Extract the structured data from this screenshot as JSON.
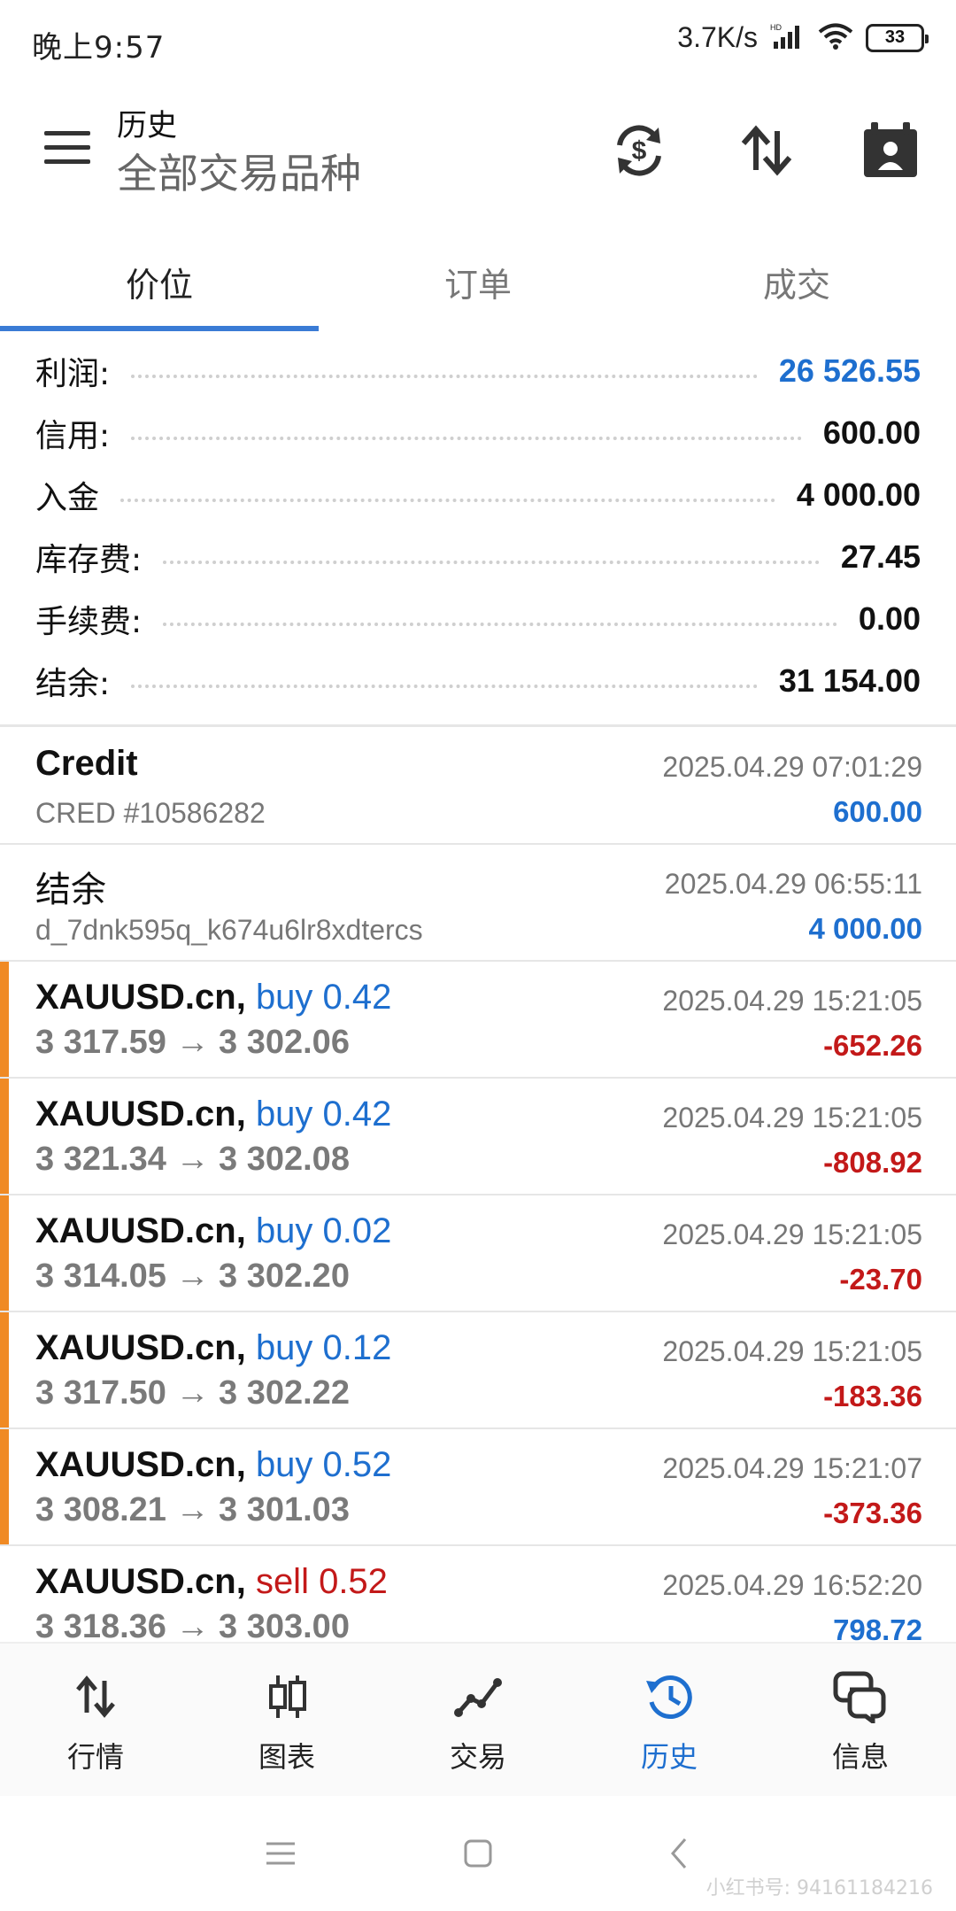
{
  "status_bar": {
    "time": "晚上9:57",
    "net_speed": "3.7K/s",
    "battery": "33"
  },
  "header": {
    "title": "历史",
    "subtitle": "全部交易品种"
  },
  "tabs": [
    {
      "label": "价位",
      "active": true
    },
    {
      "label": "订单",
      "active": false
    },
    {
      "label": "成交",
      "active": false
    }
  ],
  "summary": [
    {
      "label": "利润:",
      "value": "26 526.55",
      "color": "#1e6fcf"
    },
    {
      "label": "信用:",
      "value": "600.00"
    },
    {
      "label": "入金",
      "value": "4 000.00"
    },
    {
      "label": "库存费:",
      "value": "27.45"
    },
    {
      "label": "手续费:",
      "value": "0.00"
    },
    {
      "label": "结余:",
      "value": "31 154.00"
    }
  ],
  "records": [
    {
      "title": "Credit",
      "sub": "CRED #10586282",
      "time": "2025.04.29 07:01:29",
      "amount": "600.00"
    },
    {
      "title": "结余",
      "sub": "d_7dnk595q_k674u6lr8xdtercs",
      "time": "2025.04.29 06:55:11",
      "amount": "4 000.00"
    },
    {
      "symbol": "XAUUSD.cn,",
      "type": "buy 0.42",
      "price": "3 317.59 → 3 302.06",
      "time": "2025.04.29 15:21:05",
      "amount": "-652.26"
    },
    {
      "symbol": "XAUUSD.cn,",
      "type": "buy 0.42",
      "price": "3 321.34 → 3 302.08",
      "time": "2025.04.29 15:21:05",
      "amount": "-808.92"
    },
    {
      "symbol": "XAUUSD.cn,",
      "type": "buy 0.02",
      "price": "3 314.05 → 3 302.20",
      "time": "2025.04.29 15:21:05",
      "amount": "-23.70"
    },
    {
      "symbol": "XAUUSD.cn,",
      "type": "buy 0.12",
      "price": "3 317.50 → 3 302.22",
      "time": "2025.04.29 15:21:05",
      "amount": "-183.36"
    },
    {
      "symbol": "XAUUSD.cn,",
      "type": "buy 0.52",
      "price": "3 308.21 → 3 301.03",
      "time": "2025.04.29 15:21:07",
      "amount": "-373.36"
    },
    {
      "symbol": "XAUUSD.cn,",
      "type": "sell 0.52",
      "price": "3 318.36 → 3 303.00",
      "time": "2025.04.29 16:52:20",
      "amount": "798.72"
    }
  ],
  "bottom_nav": [
    {
      "label": "行情",
      "icon": "arrows-updown-icon"
    },
    {
      "label": "图表",
      "icon": "candlestick-icon"
    },
    {
      "label": "交易",
      "icon": "trend-icon"
    },
    {
      "label": "历史",
      "icon": "history-icon",
      "active": true
    },
    {
      "label": "信息",
      "icon": "chat-icon"
    }
  ],
  "colors": {
    "accent": "#1e6fcf",
    "loss": "#c31919",
    "trade_marker": "#f08a24"
  },
  "watermark": "小红书号: 94161184216"
}
